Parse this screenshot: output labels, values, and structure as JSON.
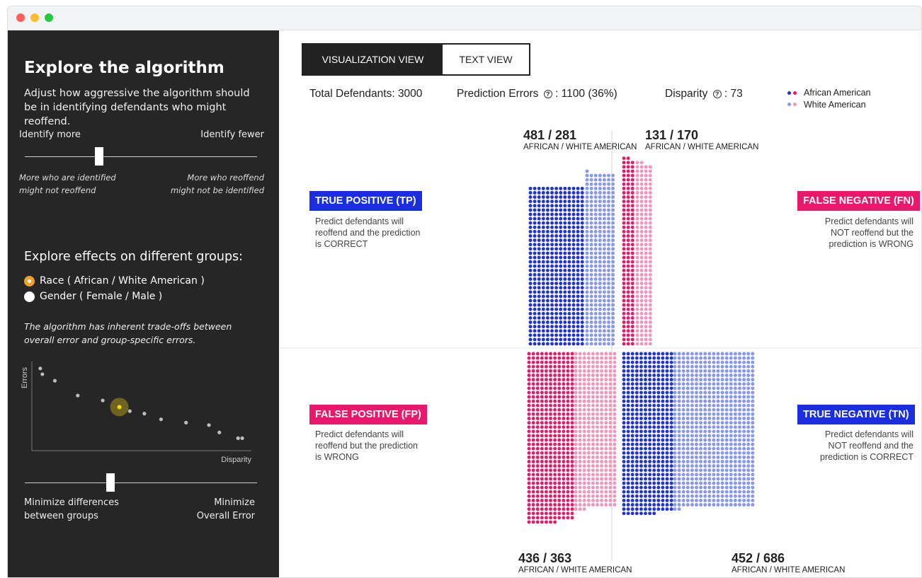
{
  "colors": {
    "african_tp": "#1f33d6",
    "white_tp": "#8797ec",
    "african_fp": "#e8186a",
    "white_fp": "#f096bc",
    "tp_badge": "#1a2ee0",
    "fp_badge": "#e8186a",
    "highlight": "#f5d90a"
  },
  "sidebar": {
    "title": "Explore the algorithm",
    "subtitle": "Adjust how aggressive the algorithm should be in identifying defendants who might reoffend.",
    "threshold": {
      "left_label": "Identify more",
      "right_label": "Identify fewer",
      "left_note_1": "More who are identified",
      "left_note_2": "might not reoffend",
      "right_note_1": "More who reoffend",
      "right_note_2": "might not be identified",
      "position": 0.32
    },
    "groups_heading": "Explore effects on different groups:",
    "options": [
      {
        "label": "Race ( African / White American )",
        "selected": true
      },
      {
        "label": "Gender ( Female / Male )",
        "selected": false
      }
    ],
    "tradeoff_note_1": "The algorithm has inherent trade-offs between",
    "tradeoff_note_2": "overall error and group-specific errors.",
    "tradeoff_chart": {
      "ylabel": "Errors",
      "xlabel": "Disparity",
      "selected_index": 5
    },
    "balance": {
      "left_label_1": "Minimize differences",
      "left_label_2": "between groups",
      "right_label_1": "Minimize",
      "right_label_2": "Overall Error",
      "position": 0.37
    }
  },
  "tabs": [
    {
      "label": "VISUALIZATION VIEW",
      "active": true
    },
    {
      "label": "TEXT VIEW",
      "active": false
    }
  ],
  "stats": {
    "total_label": "Total Defendants: 3000",
    "errors_label": "Prediction Errors",
    "errors_value": ": 1100 (36%)",
    "disparity_label": "Disparity",
    "disparity_value": ": 73",
    "help_glyph": "?"
  },
  "legend": [
    {
      "label": "African American"
    },
    {
      "label": "White American"
    }
  ],
  "quadrants": {
    "tp": {
      "badge": "TRUE POSITIVE (TP)",
      "desc": [
        "Predict defendants will",
        "reoffend and the prediction",
        "is CORRECT"
      ],
      "count": "481 / 281",
      "groups": "AFRICAN / WHITE AMERICAN"
    },
    "fn": {
      "badge": "FALSE NEGATIVE (FN)",
      "desc": [
        "Predict defendants will",
        "NOT reoffend but the",
        "prediction is WRONG"
      ],
      "count": "131 / 170",
      "groups": "AFRICAN / WHITE AMERICAN"
    },
    "fp": {
      "badge": "FALSE POSITIVE (FP)",
      "desc": [
        "Predict defendants will",
        "reoffend but the prediction",
        "is WRONG"
      ],
      "count": "436 / 363",
      "groups": "AFRICAN / WHITE AMERICAN"
    },
    "tn": {
      "badge": "TRUE NEGATIVE (TN)",
      "desc": [
        "Predict defendants will",
        "NOT reoffend and the",
        "prediction is CORRECT"
      ],
      "count": "452 / 686",
      "groups": "AFRICAN / WHITE AMERICAN"
    }
  },
  "chart_data": {
    "type": "scatter",
    "title": "",
    "xlabel": "Disparity",
    "ylabel": "Errors",
    "points": [
      [
        0.02,
        0.95
      ],
      [
        0.03,
        0.88
      ],
      [
        0.09,
        0.8
      ],
      [
        0.2,
        0.62
      ],
      [
        0.32,
        0.56
      ],
      [
        0.4,
        0.48
      ],
      [
        0.45,
        0.43
      ],
      [
        0.52,
        0.4
      ],
      [
        0.6,
        0.33
      ],
      [
        0.72,
        0.29
      ],
      [
        0.83,
        0.26
      ],
      [
        0.88,
        0.17
      ],
      [
        0.97,
        0.1
      ],
      [
        0.99,
        0.1
      ]
    ],
    "selected_index": 5
  },
  "icons": {
    "help": "question-circle-icon",
    "radio": "radio-icon"
  }
}
